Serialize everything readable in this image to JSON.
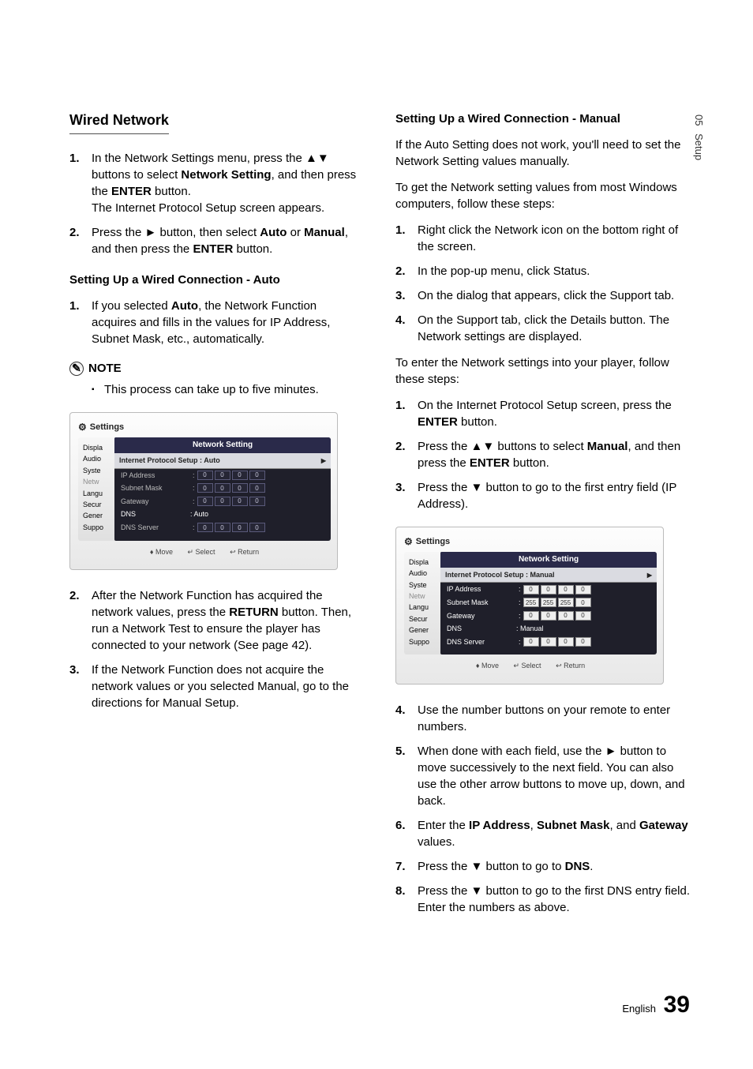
{
  "sidebar_tab": {
    "num": "05",
    "label": "Setup"
  },
  "left": {
    "heading": "Wired Network",
    "step1": {
      "num": "1.",
      "text_a": "In the Network Settings menu, press the ▲▼ buttons to select ",
      "bold_a": "Network Setting",
      "text_b": ", and then press the ",
      "bold_b": "ENTER",
      "text_c": " button.",
      "text_d": "The Internet Protocol Setup screen appears."
    },
    "step2": {
      "num": "2.",
      "text_a": "Press the ► button, then select ",
      "bold_a": "Auto",
      "text_b": " or ",
      "bold_b": "Manual",
      "text_c": ", and then press the ",
      "bold_c": "ENTER",
      "text_d": " button."
    },
    "auto_heading": "Setting Up a Wired Connection - Auto",
    "auto1": {
      "num": "1.",
      "text_a": "If you selected ",
      "bold_a": "Auto",
      "text_b": ", the Network Function acquires and fills in the values for IP Address, Subnet Mask, etc., automatically."
    },
    "note_label": "NOTE",
    "note_text": "This process can take up to five minutes.",
    "auto2": {
      "num": "2.",
      "text_a": "After the Network Function has acquired the network values, press the ",
      "bold_a": "RETURN",
      "text_b": " button. Then, run a Network Test to ensure the player has connected to your network (See page 42)."
    },
    "auto3": {
      "num": "3.",
      "text": "If the Network Function does not acquire the network values or you selected Manual, go to the directions for Manual Setup."
    }
  },
  "right": {
    "heading": "Setting Up a Wired Connection - Manual",
    "intro1": "If the Auto Setting does not work, you'll need to set the Network Setting values manually.",
    "intro2": "To get the Network setting values from most Windows computers, follow these steps:",
    "s1": {
      "num": "1.",
      "text": "Right click the Network icon on the bottom right of the screen."
    },
    "s2": {
      "num": "2.",
      "text": "In the pop-up menu, click Status."
    },
    "s3": {
      "num": "3.",
      "text": "On the dialog that appears, click the Support tab."
    },
    "s4": {
      "num": "4.",
      "text": "On the Support tab, click the Details button. The Network settings are displayed."
    },
    "intro3": "To enter the Network settings into your player, follow these steps:",
    "e1": {
      "num": "1.",
      "text_a": "On the Internet Protocol Setup screen, press the ",
      "bold_a": "ENTER",
      "text_b": " button."
    },
    "e2": {
      "num": "2.",
      "text_a": "Press the ▲▼ buttons to select ",
      "bold_a": "Manual",
      "text_b": ", and then press the ",
      "bold_b": "ENTER",
      "text_c": " button."
    },
    "e3": {
      "num": "3.",
      "text": "Press the ▼ button to go to the first entry field (IP Address)."
    },
    "e4": {
      "num": "4.",
      "text": "Use the number buttons on your remote to enter numbers."
    },
    "e5": {
      "num": "5.",
      "text": "When done with each field, use the ► button to move successively to the next field. You can also use the other arrow buttons to move up, down, and back."
    },
    "e6": {
      "num": "6.",
      "text_a": "Enter the ",
      "bold_a": "IP Address",
      "text_b": ", ",
      "bold_b": "Subnet Mask",
      "text_c": ", and ",
      "bold_c": "Gateway",
      "text_d": " values."
    },
    "e7": {
      "num": "7.",
      "text_a": "Press the ▼ button to go to ",
      "bold_a": "DNS",
      "text_b": "."
    },
    "e8": {
      "num": "8.",
      "text": "Press the ▼ button to go to the first DNS entry field. Enter the numbers as above."
    }
  },
  "settings_auto": {
    "window_title": "Settings",
    "panel_title": "Network Setting",
    "ipsetup_label": "Internet Protocol Setup",
    "ipsetup_value": ": Auto",
    "rows": {
      "ip": "IP Address",
      "subnet": "Subnet Mask",
      "gateway": "Gateway",
      "dns": "DNS",
      "dns_value": ": Auto",
      "dns_server": "DNS Server"
    },
    "v0": "0",
    "sidebar": [
      "Displa",
      "Audio",
      "Syste",
      "Netw",
      "Langu",
      "Secur",
      "Gener",
      "Suppo"
    ],
    "footer": {
      "move": "> Move",
      "select": "s Select",
      "return": "r Return",
      "move_icon": "▲▼",
      "select_icon": "↵",
      "return_icon": "↩"
    }
  },
  "settings_manual": {
    "window_title": "Settings",
    "panel_title": "Network Setting",
    "ipsetup_label": "Internet Protocol Setup",
    "ipsetup_value": ": Manual",
    "rows": {
      "ip": "IP Address",
      "subnet": "Subnet Mask",
      "gateway": "Gateway",
      "dns": "DNS",
      "dns_value": ": Manual",
      "dns_server": "DNS Server"
    },
    "subnet_vals": [
      "255",
      "255",
      "255",
      "0"
    ],
    "ip_vals": [
      "0",
      "0",
      "0",
      "0"
    ],
    "gw_vals": [
      "0",
      "0",
      "0",
      "0"
    ],
    "dnss_vals": [
      "0",
      "0",
      "0",
      "0"
    ],
    "sidebar": [
      "Displa",
      "Audio",
      "Syste",
      "Netw",
      "Langu",
      "Secur",
      "Gener",
      "Suppo"
    ]
  },
  "footer": {
    "lang": "English",
    "page": "39"
  }
}
